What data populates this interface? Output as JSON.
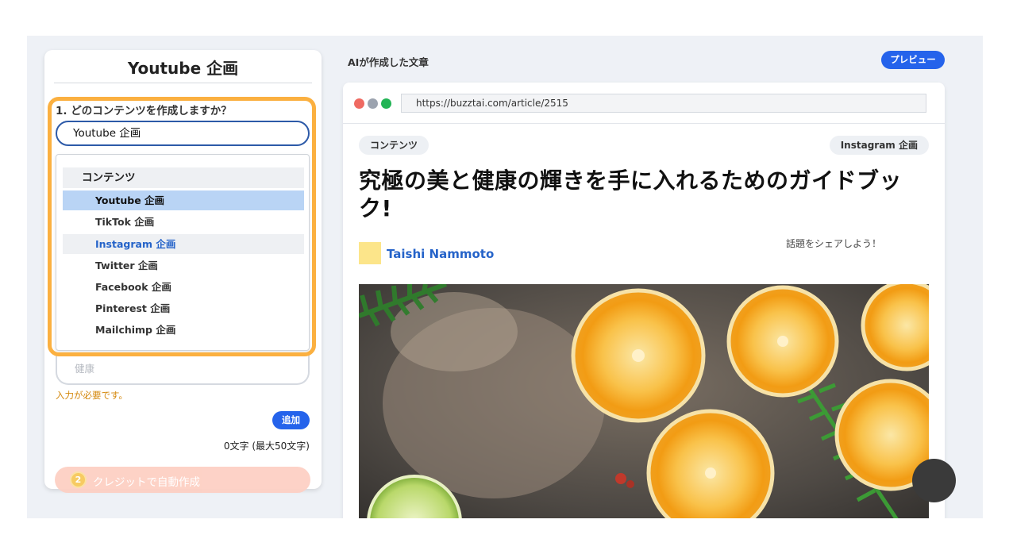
{
  "left_panel": {
    "title": "Youtube 企画",
    "question": "1. どのコンテンツを作成しますか？",
    "selected_value": "Youtube 企画",
    "dropdown": {
      "group_label": "コンテンツ",
      "items": [
        {
          "label": "Youtube 企画",
          "state": "selected"
        },
        {
          "label": "TikTok 企画",
          "state": "normal"
        },
        {
          "label": "Instagram 企画",
          "state": "hover"
        },
        {
          "label": "Twitter 企画",
          "state": "normal"
        },
        {
          "label": "Facebook 企画",
          "state": "normal"
        },
        {
          "label": "Pinterest 企画",
          "state": "normal"
        },
        {
          "label": "Mailchimp 企画",
          "state": "normal"
        }
      ]
    },
    "keyword_partial": "健康",
    "error_text": "入力が必要です。",
    "add_label": "追加",
    "char_count": "0文字 (最大50文字)",
    "credit_count": "2",
    "auto_create_label": "クレジットで自動作成"
  },
  "right": {
    "ai_label": "AIが作成した文章",
    "preview_label": "プレビュー",
    "url": "https://buzztai.com/article/2515",
    "tag_left": "コンテンツ",
    "tag_right": "Instagram 企画",
    "article_title": "究極の美と健康の輝きを手に入れるためのガイドブック!",
    "share_text": "話題をシェアしよう！",
    "author": "Taishi Nammoto"
  },
  "colors": {
    "accent": "#2563eb",
    "highlight": "#fbb040",
    "error": "#d4880c",
    "selected_item": "#b9d4f5"
  }
}
